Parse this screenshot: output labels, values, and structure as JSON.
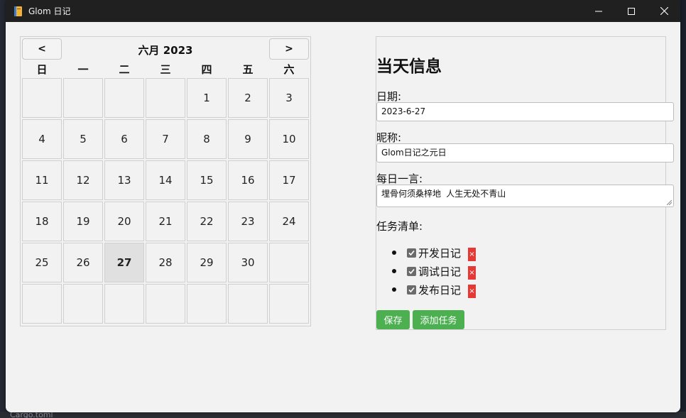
{
  "desktop": {
    "bottom_text": "Cargo.toml"
  },
  "window": {
    "title": "Glom 日记",
    "app_icon": "notebook-icon",
    "controls": {
      "minimize": "minimize-icon",
      "maximize": "maximize-icon",
      "close": "close-icon"
    }
  },
  "calendar": {
    "prev_label": "<",
    "next_label": ">",
    "month_title": "六月 2023",
    "weekdays": [
      "日",
      "一",
      "二",
      "三",
      "四",
      "五",
      "六"
    ],
    "days": [
      "",
      "",
      "",
      "",
      "1",
      "2",
      "3",
      "4",
      "5",
      "6",
      "7",
      "8",
      "9",
      "10",
      "11",
      "12",
      "13",
      "14",
      "15",
      "16",
      "17",
      "18",
      "19",
      "20",
      "21",
      "22",
      "23",
      "24",
      "25",
      "26",
      "27",
      "28",
      "29",
      "30",
      "",
      "",
      "",
      "",
      "",
      "",
      "",
      ""
    ],
    "selected_day": "27"
  },
  "info": {
    "title": "当天信息",
    "date_label": "日期:",
    "date_value": "2023-6-27",
    "nickname_label": "昵称:",
    "nickname_value": "Glom日记之元日",
    "quote_label": "每日一言:",
    "quote_value": "埋骨何须桑梓地 人生无处不青山",
    "tasks_label": "任务清单:",
    "tasks": [
      {
        "text": "开发日记",
        "checked": true,
        "delete_label": "×"
      },
      {
        "text": "调试日记",
        "checked": true,
        "delete_label": "×"
      },
      {
        "text": "发布日记",
        "checked": true,
        "delete_label": "×"
      }
    ],
    "save_label": "保存",
    "add_task_label": "添加任务"
  },
  "colors": {
    "titlebar": "#202020",
    "window_bg": "#f2f2f2",
    "accent_green": "#4caf50",
    "delete_red": "#e53935",
    "today_bg": "#e0e0e0"
  }
}
